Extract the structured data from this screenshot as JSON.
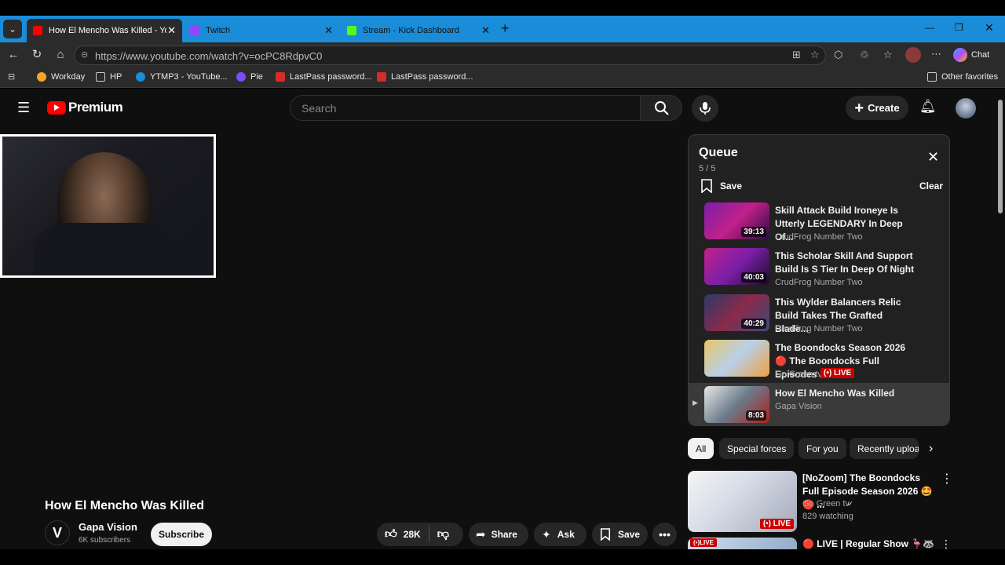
{
  "browser": {
    "tabs": [
      {
        "label": "How El Mencho Was Killed - YouTube",
        "active": true,
        "favicon_color": "#ff0000"
      },
      {
        "label": "Twitch",
        "active": false,
        "favicon_color": "#9146ff"
      },
      {
        "label": "Stream - Kick Dashboard",
        "active": false,
        "favicon_color": "#53fc18"
      }
    ],
    "url": "https://www.youtube.com/watch?v=ocPC8RdpvC0",
    "chat_label": "Chat",
    "bookmarks": [
      "Workday",
      "HP",
      "YTMP3 - YouTube...",
      "Pie",
      "LastPass password...",
      "LastPass password..."
    ],
    "other_favorites": "Other favorites"
  },
  "youtube": {
    "logo": "Premium",
    "search_placeholder": "Search",
    "create_label": "Create",
    "queue": {
      "title": "Queue",
      "count": "5 / 5",
      "save_label": "Save",
      "clear_label": "Clear",
      "items": [
        {
          "title": "Skill Attack Build Ironeye Is Utterly LEGENDARY In Deep Of...",
          "channel": "CrudFrog Number Two",
          "duration": "39:13"
        },
        {
          "title": "This Scholar Skill And Support Build Is S Tier In Deep Of Night",
          "channel": "CrudFrog Number Two",
          "duration": "40:03"
        },
        {
          "title": "This Wylder Balancers Relic Build Takes The Grafted Blade...",
          "channel": "CrudFrog Number Two",
          "duration": "40:29"
        },
        {
          "title": "The Boondocks Season 2026 🔴 The Boondocks Full Episodes ...",
          "channel": "Go Green tv",
          "duration": "LIVE"
        },
        {
          "title": "How El Mencho Was Killed",
          "channel": "Gapa Vision",
          "duration": "8:03",
          "playing": true
        }
      ]
    },
    "chips": [
      "All",
      "Special forces",
      "For you",
      "Recently uploaded"
    ],
    "recommendations": [
      {
        "title": "[NoZoom] The Boondocks Full Episode Season 2026 🤩🔴 ...",
        "channel": "Go Green tv",
        "meta": "829 watching",
        "badge": "LIVE"
      },
      {
        "title": "🔴 LIVE | Regular Show 🦩🦝 |",
        "badge": "LIVE"
      }
    ],
    "video": {
      "title": "How El Mencho Was Killed",
      "channel": "Gapa Vision",
      "subscribers": "6K subscribers",
      "subscribe_label": "Subscribe",
      "likes": "28K",
      "share_label": "Share",
      "ask_label": "Ask",
      "save_label": "Save"
    }
  }
}
